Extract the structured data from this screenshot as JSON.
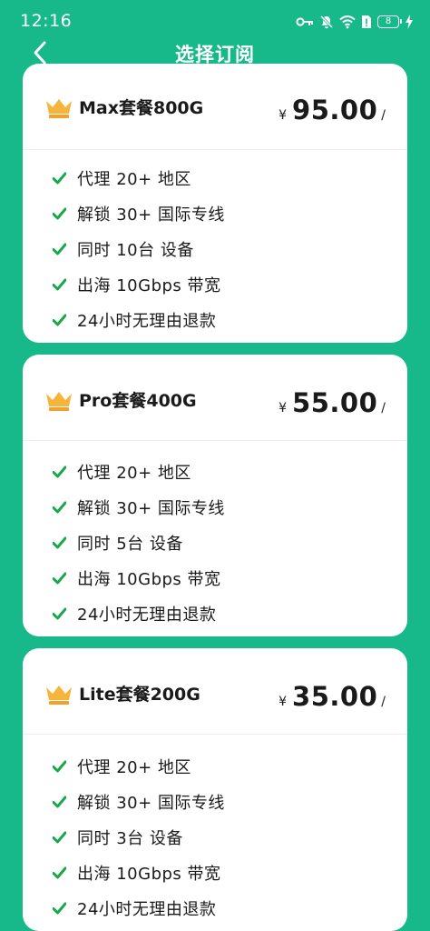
{
  "status_bar": {
    "time": "12:16",
    "battery_level": "8",
    "icons": [
      "key-icon",
      "bell-muted-icon",
      "wifi-icon",
      "sim-alert-icon",
      "battery-icon",
      "charging-icon"
    ]
  },
  "nav": {
    "back_icon": "chevron-left-icon",
    "title": "选择订阅"
  },
  "colors": {
    "background": "#17b98a",
    "card": "#ffffff",
    "check": "#18a84a",
    "crown": "#f5b43a"
  },
  "plans": [
    {
      "name": "Max套餐800G",
      "currency": "¥",
      "price": "95.00",
      "suffix": "/",
      "features": [
        "代理 20+ 地区",
        "解锁 30+ 国际专线",
        "同时 10台 设备",
        "出海 10Gbps 带宽",
        "24小时无理由退款"
      ]
    },
    {
      "name": "Pro套餐400G",
      "currency": "¥",
      "price": "55.00",
      "suffix": "/",
      "features": [
        "代理 20+ 地区",
        "解锁 30+ 国际专线",
        "同时 5台 设备",
        "出海 10Gbps 带宽",
        "24小时无理由退款"
      ]
    },
    {
      "name": "Lite套餐200G",
      "currency": "¥",
      "price": "35.00",
      "suffix": "/",
      "features": [
        "代理 20+ 地区",
        "解锁 30+ 国际专线",
        "同时 3台 设备",
        "出海 10Gbps 带宽",
        "24小时无理由退款"
      ]
    }
  ]
}
